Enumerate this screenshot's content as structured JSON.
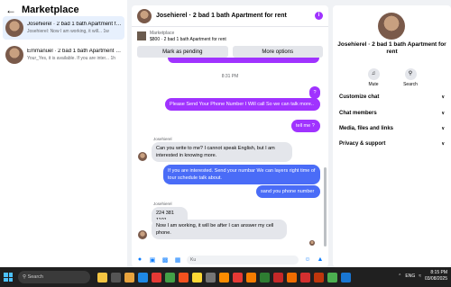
{
  "left": {
    "title": "Marketplace",
    "conversations": [
      {
        "name": "Josehierel · 2 bad 1 bath Apartment for rent",
        "preview": "Josehierel: Now I am working, it will...  1w"
      },
      {
        "name": "Emmanuel · 2 bad 1 bath Apartment for rent",
        "preview": "Your_Yes, it is available. If you are inter...  1h"
      }
    ]
  },
  "chat": {
    "title": "Josehierel · 2 bad 1 bath Apartment for rent",
    "info_badge": "i",
    "listing_source": "Marketplace",
    "listing_desc": "$800 · 2 bad 1 bath Apartment for rent",
    "mark_pending": "Mark as pending",
    "more_options": "More options",
    "timestamp": "8:31 PM",
    "messages": {
      "m1": "?",
      "m2": "Please Send Your Phone Number I Will call So we can talk more..",
      "m3": "tell me ?",
      "sender1": "Josehierel",
      "m4": "Can you write to me? I cannot speak English, but I am interested in knowing more.",
      "m5": "If you are interested. Send your numbar We can layers right time of tour  schedule talk about.",
      "m6": "sand you phone number",
      "sender2": "Josehierel",
      "m7": "224 381 1101",
      "m8": "Now I am working, it will be after I can answer my cell phone."
    },
    "composer_value": "Ku"
  },
  "right": {
    "name": "Josehierel · 2 bad 1 bath Apartment for rent",
    "mute": "Mute",
    "search": "Search",
    "rows": [
      "Customize chat",
      "Chat members",
      "Media, files and links",
      "Privacy & support"
    ]
  },
  "taskbar": {
    "search_placeholder": "Search",
    "tray_lang": "ENG",
    "time": "8:15 PM",
    "date": "03/08/2025"
  },
  "colors": {
    "accent": "#a033ff",
    "blue_bubble": "#4a6cf7",
    "messenger_blue": "#0a7cff"
  }
}
